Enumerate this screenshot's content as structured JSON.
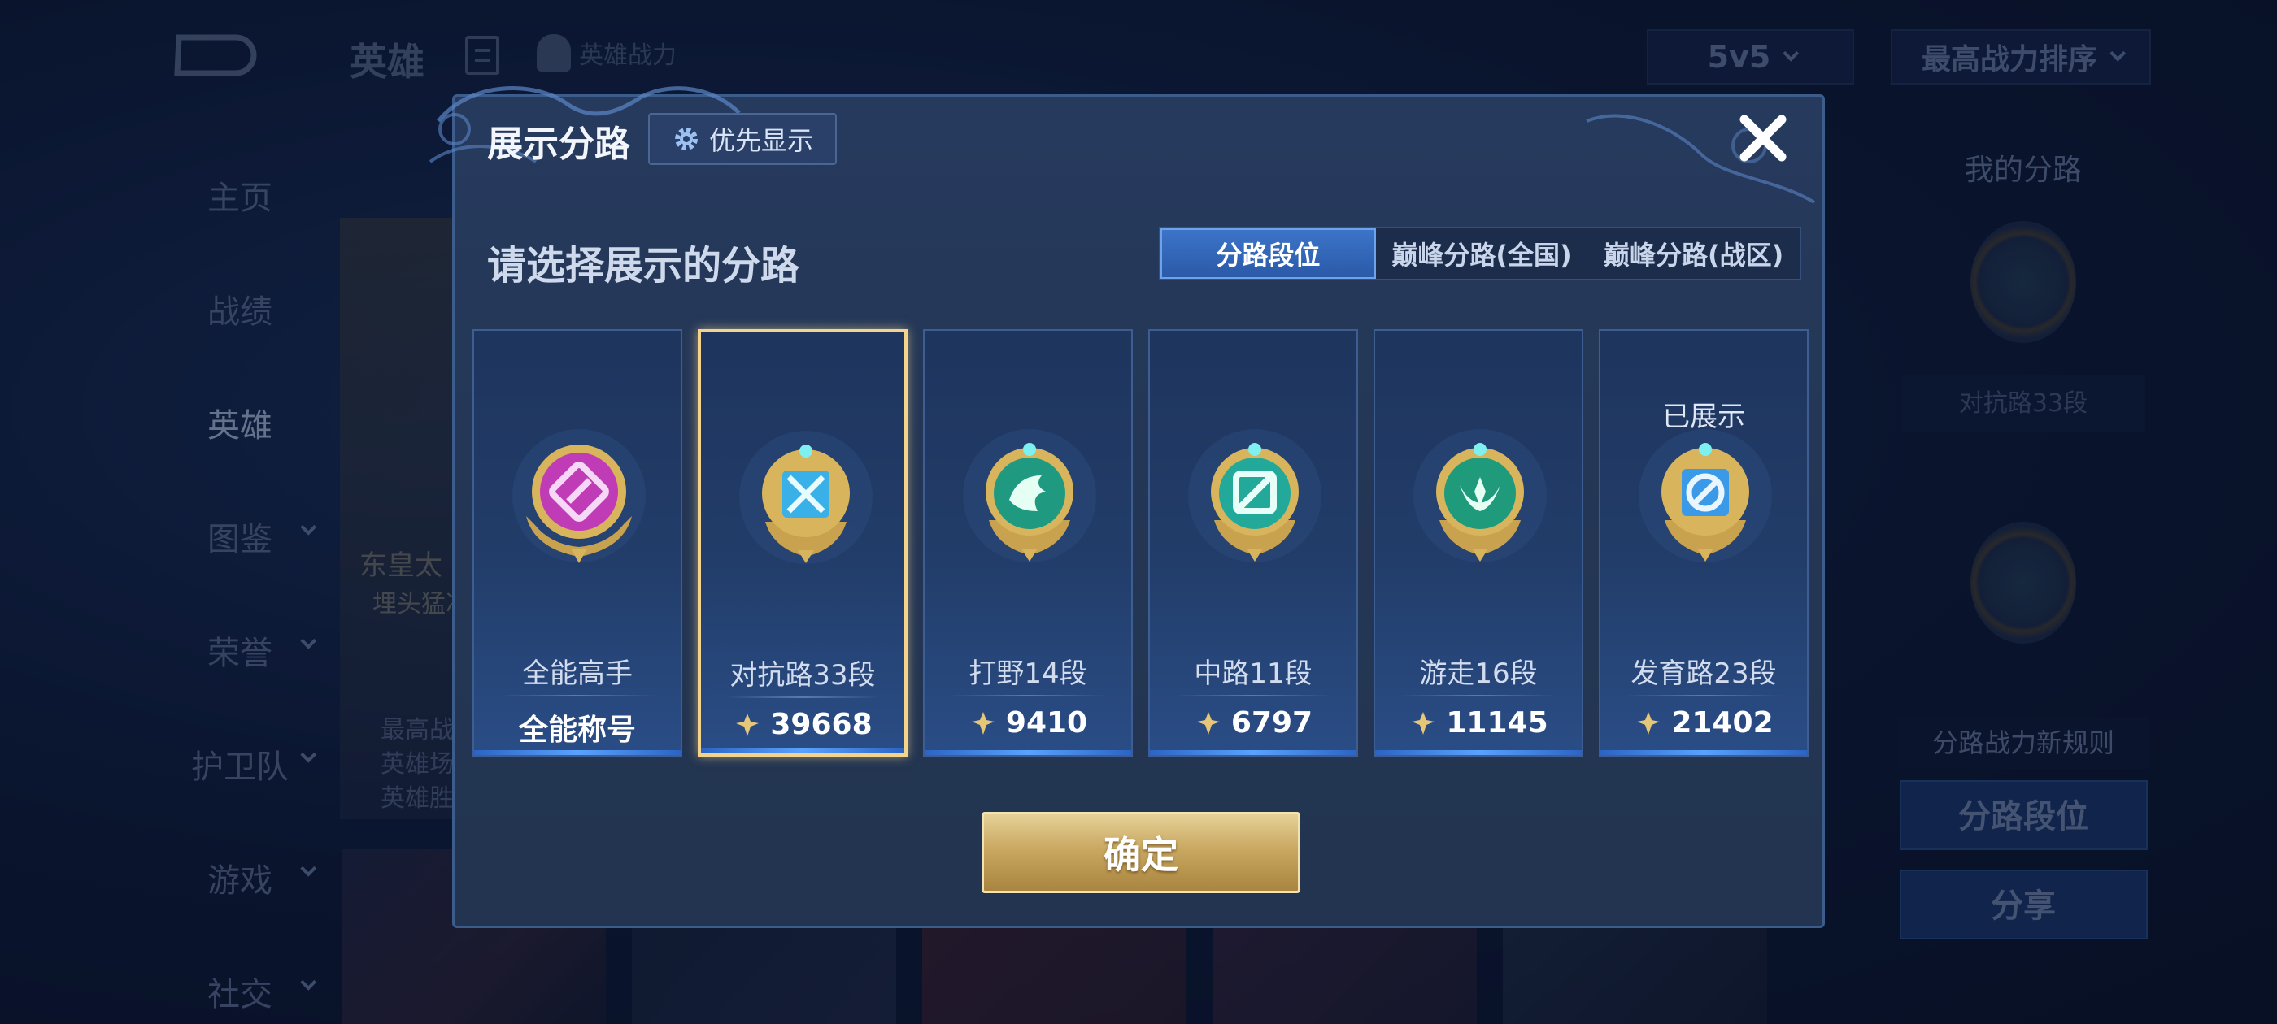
{
  "header": {
    "title": "英雄",
    "power_label": "英雄战力",
    "mode": "5v5",
    "sort": "最高战力排序"
  },
  "sidebar": {
    "items": [
      {
        "label": "主页"
      },
      {
        "label": "战绩"
      },
      {
        "label": "英雄"
      },
      {
        "label": "图鉴"
      },
      {
        "label": "荣誉"
      },
      {
        "label": "护卫队"
      },
      {
        "label": "游戏"
      },
      {
        "label": "社交"
      }
    ]
  },
  "hero_card": {
    "name": "东皇太",
    "subtitle": "埋头猛冲",
    "stats": [
      "最高战",
      "英雄场",
      "英雄胜"
    ]
  },
  "right_panel": {
    "title": "我的分路",
    "current_label": "对抗路33段",
    "rule_label": "分路战力新规则",
    "rank_button": "分路段位",
    "share_button": "分享"
  },
  "modal": {
    "title": "展示分路",
    "priority_button": "优先显示",
    "subtitle": "请选择展示的分路",
    "tabs": [
      {
        "label": "分路段位",
        "active": true
      },
      {
        "label": "巅峰分路(全国)",
        "active": false
      },
      {
        "label": "巅峰分路(战区)",
        "active": false
      }
    ],
    "cards": [
      {
        "name": "全能高手",
        "value": "全能称号",
        "icon": "all-round-badge-icon",
        "color": "#c03bb6"
      },
      {
        "name": "对抗路33段",
        "value": "39668",
        "icon": "clash-lane-badge-icon",
        "color": "#3ab0e8"
      },
      {
        "name": "打野14段",
        "value": "9410",
        "icon": "jungle-badge-icon",
        "color": "#1f9a80"
      },
      {
        "name": "中路11段",
        "value": "6797",
        "icon": "mid-lane-badge-icon",
        "color": "#22a99a"
      },
      {
        "name": "游走16段",
        "value": "11145",
        "icon": "roam-badge-icon",
        "color": "#1f9a7a"
      },
      {
        "name": "发育路23段",
        "value": "21402",
        "icon": "farm-lane-badge-icon",
        "color": "#3a9ae8",
        "shown_label": "已展示"
      }
    ],
    "confirm_button": "确定"
  },
  "colors": {
    "accent_gold": "#f4d38d",
    "tab_active": "#3c74c8"
  }
}
